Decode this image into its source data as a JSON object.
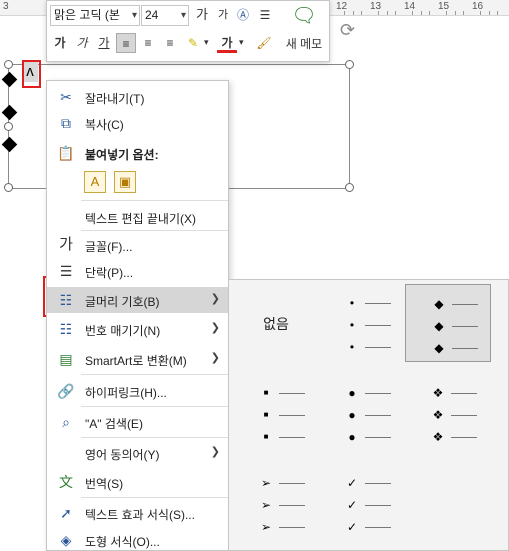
{
  "ruler": {
    "numbers": [
      {
        "label": "3",
        "pos": "p1"
      },
      {
        "label": "12",
        "pos": "p2"
      },
      {
        "label": "13",
        "pos": "p3"
      },
      {
        "label": "14",
        "pos": "p4"
      },
      {
        "label": "15",
        "pos": "p5"
      },
      {
        "label": "16",
        "pos": "p6"
      }
    ]
  },
  "slide": {
    "cursor_char": "ʌ"
  },
  "mini_toolbar": {
    "font_name": "맑은 고딕 (본",
    "font_size": "24",
    "grow_font": "가",
    "shrink_font": "가",
    "clear_format": "Ⓐ",
    "bold": "가",
    "italic": "가",
    "underline": "가",
    "font_color_letter": "가",
    "new_comment_label": "새 메모"
  },
  "context_menu": {
    "items": [
      {
        "key": "cut",
        "label": "잘라내기(T)",
        "icon": "scissors-icon"
      },
      {
        "key": "copy",
        "label": "복사(C)",
        "icon": "copy-icon"
      },
      {
        "key": "paste_options",
        "label": "붙여넣기 옵션:",
        "icon": "clipboard-icon"
      },
      {
        "key": "exit_text_edit",
        "label": "텍스트 편집 끝내기(X)",
        "icon": ""
      },
      {
        "key": "font",
        "label": "글꼴(F)...",
        "icon": "font-icon"
      },
      {
        "key": "paragraph",
        "label": "단락(P)...",
        "icon": "paragraph-icon"
      },
      {
        "key": "bullets",
        "label": "글머리 기호(B)",
        "icon": "bullets-icon"
      },
      {
        "key": "numbering",
        "label": "번호 매기기(N)",
        "icon": "numbering-icon"
      },
      {
        "key": "smartart",
        "label": "SmartArt로 변환(M)",
        "icon": "smartart-icon"
      },
      {
        "key": "hyperlink",
        "label": "하이퍼링크(H)...",
        "icon": "link-icon"
      },
      {
        "key": "search",
        "label": "\"A\" 검색(E)",
        "icon": "search-icon"
      },
      {
        "key": "synonyms",
        "label": "영어 동의어(Y)",
        "icon": ""
      },
      {
        "key": "translate",
        "label": "번역(S)",
        "icon": "translate-icon"
      },
      {
        "key": "text_effects",
        "label": "텍스트 효과 서식(S)...",
        "icon": "text-effects-icon"
      },
      {
        "key": "shape_format",
        "label": "도형 서식(O)...",
        "icon": "shape-format-icon"
      }
    ]
  },
  "bullet_menu": {
    "none_label": "없음",
    "options": [
      {
        "name": "none",
        "symbol": "",
        "selected": false
      },
      {
        "name": "small-dot",
        "symbol": "•",
        "selected": false
      },
      {
        "name": "diamond",
        "symbol": "◆",
        "selected": true
      },
      {
        "name": "square",
        "symbol": "■",
        "selected": false
      },
      {
        "name": "large-dot",
        "symbol": "●",
        "selected": false
      },
      {
        "name": "four-diamond",
        "symbol": "❖",
        "selected": false
      },
      {
        "name": "arrow",
        "symbol": "➢",
        "selected": false
      },
      {
        "name": "check",
        "symbol": "✓",
        "selected": false
      }
    ]
  },
  "colors": {
    "highlight": "#e02020",
    "hover": "#d6d6d6",
    "accent": "#2b579a"
  }
}
